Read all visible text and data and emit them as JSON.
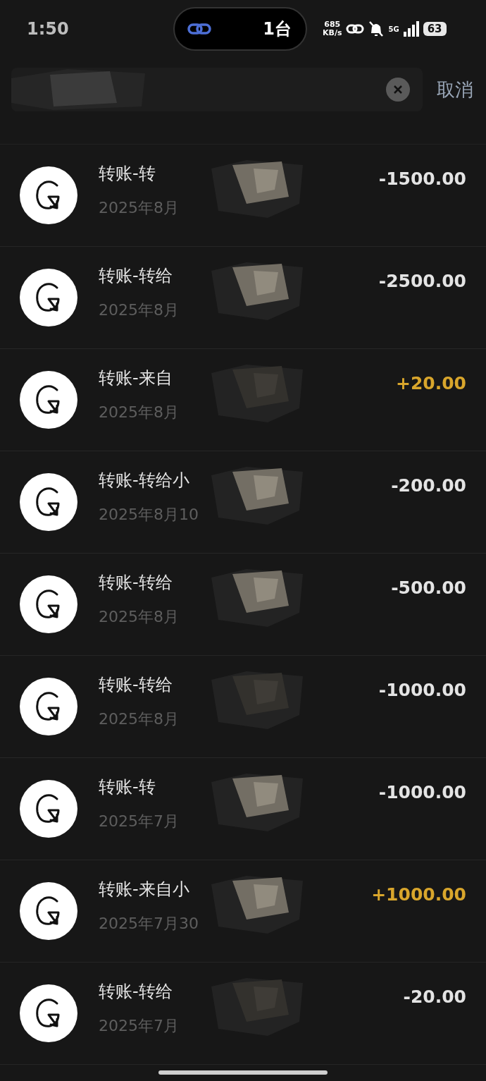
{
  "status_bar": {
    "time": "1:50",
    "island": {
      "text": "1台"
    },
    "net_speed": {
      "value": "685",
      "unit": "KB/s"
    },
    "network": "5G",
    "battery": "63"
  },
  "search": {
    "cancel": "取消"
  },
  "transactions": [
    {
      "title": "转账-转",
      "date": "2025年8月",
      "amount": "-1500.00",
      "kind": "expense"
    },
    {
      "title": "转账-转给",
      "date": "2025年8月",
      "amount": "-2500.00",
      "kind": "expense"
    },
    {
      "title": "转账-来自",
      "date": "2025年8月",
      "amount": "+20.00",
      "kind": "income"
    },
    {
      "title": "转账-转给小",
      "date": "2025年8月10",
      "amount": "-200.00",
      "kind": "expense"
    },
    {
      "title": "转账-转给",
      "date": "2025年8月",
      "amount": "-500.00",
      "kind": "expense"
    },
    {
      "title": "转账-转给",
      "date": "2025年8月",
      "amount": "-1000.00",
      "kind": "expense"
    },
    {
      "title": "转账-转",
      "date": "2025年7月",
      "amount": "-1000.00",
      "kind": "expense"
    },
    {
      "title": "转账-来自小",
      "date": "2025年7月30",
      "amount": "+1000.00",
      "kind": "income"
    },
    {
      "title": "转账-转给",
      "date": "2025年7月",
      "amount": "-20.00",
      "kind": "expense"
    }
  ]
}
